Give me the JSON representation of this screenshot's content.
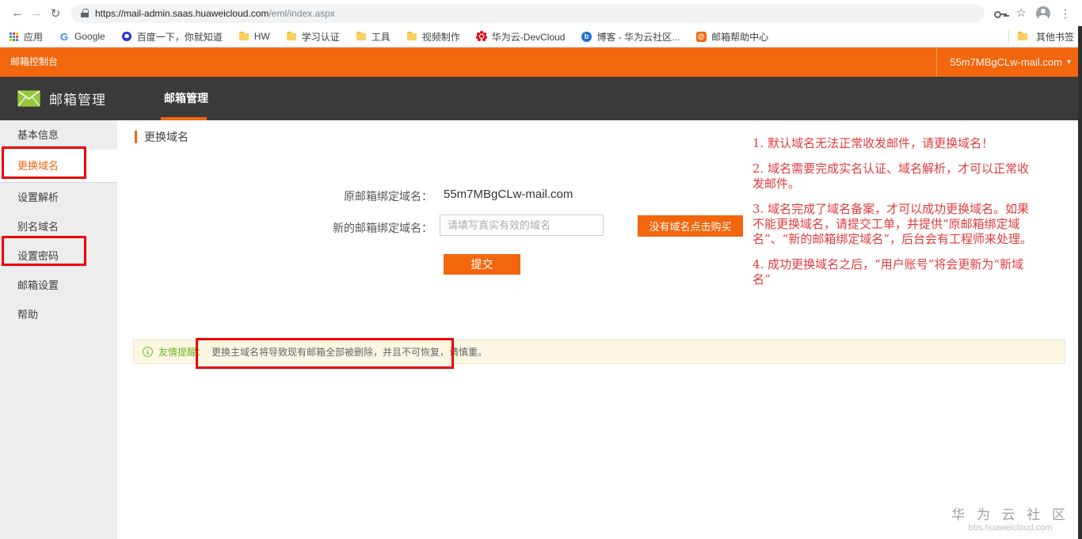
{
  "browser": {
    "url_domain": "https://mail-admin.saas.huaweicloud.com",
    "url_path": "/eml/index.aspx",
    "bookmarks": [
      {
        "label": "应用",
        "icon": "apps-grid"
      },
      {
        "label": "Google",
        "icon": "google-g"
      },
      {
        "label": "百度一下，你就知道",
        "icon": "baidu"
      },
      {
        "label": "HW",
        "icon": "folder"
      },
      {
        "label": "学习认证",
        "icon": "folder"
      },
      {
        "label": "工具",
        "icon": "folder"
      },
      {
        "label": "视频制作",
        "icon": "folder"
      },
      {
        "label": "华为云-DevCloud",
        "icon": "huawei"
      },
      {
        "label": "博客 - 华为云社区...",
        "icon": "blog"
      },
      {
        "label": "邮箱帮助中心",
        "icon": "mail-help"
      }
    ],
    "other_bookmarks": "其他书签"
  },
  "topbar": {
    "console_label": "邮箱控制台",
    "account": "55m7MBgCLw-mail.com",
    "caret": "▾"
  },
  "header": {
    "brand": "邮箱管理",
    "tab": "邮箱管理"
  },
  "sidebar": {
    "items": [
      {
        "label": "基本信息",
        "active": false
      },
      {
        "label": "更换域名",
        "active": true
      },
      {
        "label": "设置解析",
        "active": false
      },
      {
        "label": "别名域名",
        "active": false
      },
      {
        "label": "设置密码",
        "active": false
      },
      {
        "label": "邮箱设置",
        "active": false
      },
      {
        "label": "帮助",
        "active": false
      }
    ]
  },
  "main": {
    "title": "更换域名",
    "form": {
      "original_label": "原邮箱绑定域名：",
      "original_value": "55m7MBgCLw-mail.com",
      "new_label": "新的邮箱绑定域名：",
      "new_placeholder": "请填写真实有效的域名",
      "new_value": "",
      "buy_button": "没有域名点击购买",
      "submit_button": "提交"
    },
    "tips": [
      "1. 默认域名无法正常收发邮件，请更换域名！",
      "2. 域名需要完成实名认证、域名解析，才可以正常收发邮件。",
      "3. 域名完成了域名备案，才可以成功更换域名。如果不能更换域名，请提交工单，并提供“原邮箱绑定域名”、“新的邮箱绑定域名”，后台会有工程师来处理。",
      "4. 成功更换域名之后，“用户账号”将会更新为“新域名”"
    ],
    "notice": {
      "label": "友情提醒：",
      "text": "更换主域名将导致现有邮箱全部被删除，并且不可恢复，请慎重。"
    },
    "watermark": {
      "line1": "华 为 云 社 区",
      "line2": "bbs.huaweicloud.com"
    }
  },
  "colors": {
    "accent_orange": "#f2660d",
    "header_dark": "#3a3a3a",
    "annotation_red": "#ee0000",
    "notice_green": "#6fb32a",
    "tip_red": "#e23b3b"
  }
}
